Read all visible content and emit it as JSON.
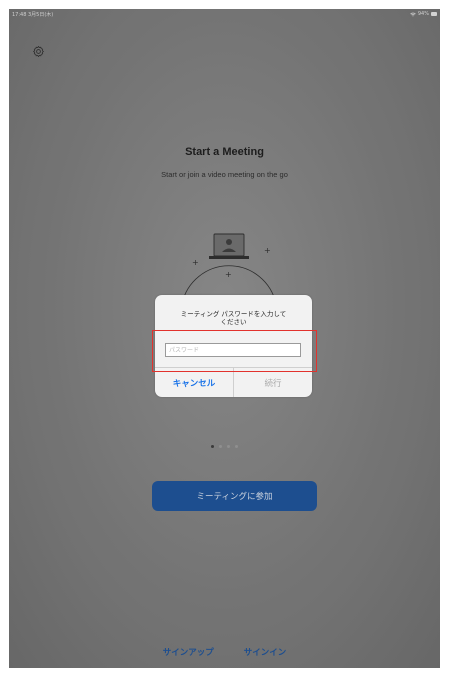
{
  "status_bar": {
    "time": "17:48 3月5日(木)",
    "battery": "94%"
  },
  "main": {
    "title": "Start a Meeting",
    "subtitle": "Start or join a video meeting on the go"
  },
  "dialog": {
    "message": "ミーティング パスワードを入力して\nください",
    "password_placeholder": "パスワード",
    "password_value": "",
    "cancel_label": "キャンセル",
    "continue_label": "続行"
  },
  "pagination": {
    "total": 4,
    "current": 1
  },
  "join_button_label": "ミーティングに参加",
  "footer": {
    "signup_label": "サインアップ",
    "signin_label": "サインイン"
  },
  "colors": {
    "accent": "#1a73e8",
    "button_bg": "#1d4e8f",
    "highlight": "#e2322d"
  }
}
